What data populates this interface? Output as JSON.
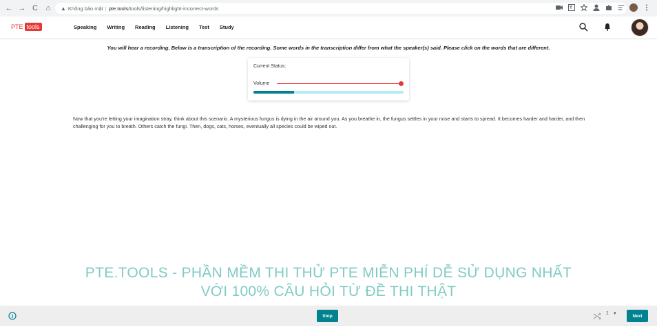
{
  "browser": {
    "back_icon": "←",
    "forward_icon": "→",
    "reload_icon": "C",
    "home_icon": "⌂",
    "warning_icon": "▲",
    "security_text": "Không bảo mật",
    "separator": "|",
    "url_host": "pte.tools",
    "url_path": "/tools/listening/highlight-incorrect-words"
  },
  "header": {
    "logo_pte": "PTE",
    "logo_tools": "tools",
    "nav": [
      "Speaking",
      "Writing",
      "Reading",
      "Listening",
      "Test",
      "Study"
    ]
  },
  "instruction": "You will hear a recording. Below is a transcription of the recording. Some words in the transcription differ from what the speaker(s) said. Please click on the words that are different.",
  "audio": {
    "status_label": "Current Status:",
    "volume_label": "Volume",
    "volume_level": 1.0,
    "progress": 0.27
  },
  "transcript": "Now that you're letting your imagination stray, think about this scenario. A mysterious fungus is dying in the air around you. As you breathe in, the fungus settles in your nose and starts to spread. It becomes harder and harder, and then challenging for you to breath. Others catch the fungi. Then, dogs, cats, horses, eventually all species could be wiped out.",
  "watermark": {
    "line1": "PTE.TOOLS - PHẦN MỀM THI THỬ PTE MIỄN PHÍ DỄ SỬ DỤNG NHẤT",
    "line2": "VỚI 100% CÂU HỎI TỪ ĐỀ THI THẬT"
  },
  "footer": {
    "stop_label": "Stop",
    "page_number": "1",
    "caret": "▼",
    "next_label": "Next"
  },
  "colors": {
    "accent": "#00838f",
    "brand": "#e53935",
    "watermark": "#80cbc4"
  }
}
